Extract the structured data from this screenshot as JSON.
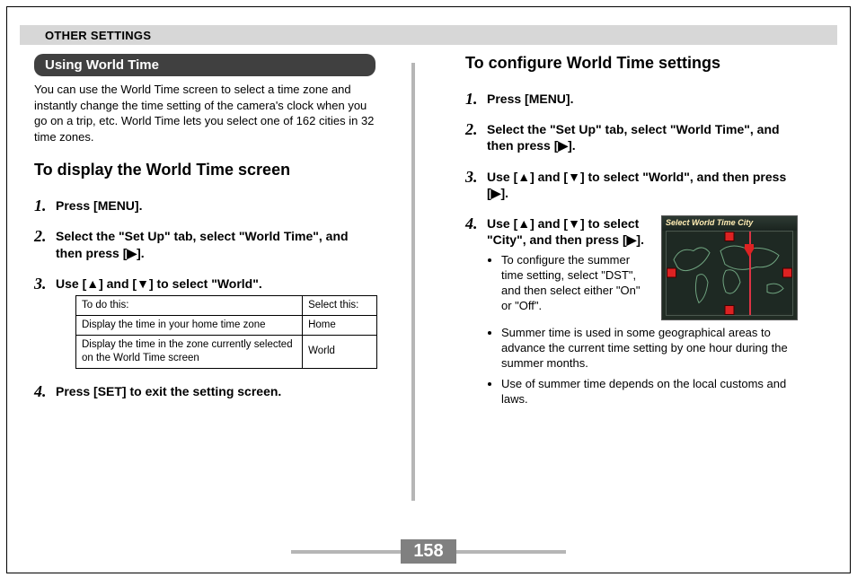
{
  "header": "OTHER SETTINGS",
  "page_number": "158",
  "glyphs": {
    "up": "▲",
    "down": "▼",
    "right": "▶"
  },
  "left": {
    "pill": "Using World Time",
    "intro": "You can use the World Time screen to select a time zone and instantly change the time setting of the camera's clock when you go on a trip, etc. World Time lets you select one of 162 cities in 32 time zones.",
    "subheading": "To display the World Time screen",
    "steps": {
      "s1": "Press [MENU].",
      "s2a": "Select the \"Set Up\" tab, select \"World Time\", and then press [",
      "s2b": "].",
      "s3a": "Use [",
      "s3b": "] and [",
      "s3c": "] to select \"World\".",
      "s4": "Press [SET] to exit the setting screen."
    },
    "table": {
      "h1": "To do this:",
      "h2": "Select this:",
      "rows": [
        {
          "a": "Display the time in your home time zone",
          "b": "Home"
        },
        {
          "a": "Display the time in the zone currently selected on the World Time screen",
          "b": "World"
        }
      ]
    }
  },
  "right": {
    "heading": "To configure World Time settings",
    "steps": {
      "s1": "Press [MENU].",
      "s2a": "Select the \"Set Up\" tab, select \"World Time\", and then press [",
      "s2b": "].",
      "s3a": "Use [",
      "s3b": "] and [",
      "s3c": "] to select \"World\", and then press [",
      "s3d": "].",
      "s4a": "Use [",
      "s4b": "] and [",
      "s4c": "] to select \"City\", and then press [",
      "s4d": "]."
    },
    "bullets": {
      "b1": "To configure the summer time setting, select \"DST\", and then select either \"On\" or \"Off\".",
      "b2": "Summer time is used in some geographical areas to advance the current time setting by one hour during the summer months.",
      "b3": "Use of summer time depends on the local customs and laws."
    },
    "screen_title": "Select World Time City"
  }
}
